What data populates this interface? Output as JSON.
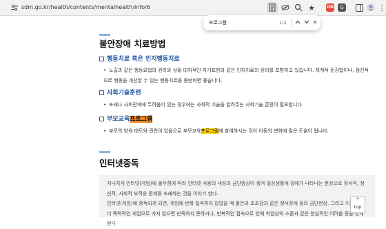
{
  "browser": {
    "url": "sdm.go.kr/health/contents/mentalhealth/info/6",
    "ext_red_label": "ON",
    "ext_gray_label": "G"
  },
  "find": {
    "query": "프로그램",
    "count": "1/2"
  },
  "section1": {
    "title": "불안장애 치료방법",
    "items": [
      {
        "heading": "행동치료 혹은 인지행동치료",
        "text": "노출과 같은 행동요법의 원리와 상황 대처적인 자기표현과 같은 인지치료의 원리를 포함하고 있습니다. 체계적 둔감법이나, 점진적으로 행동을 개선할 수 있는 행동치료를 동반하면 좋습니다."
      },
      {
        "heading": "사회기술훈련",
        "text": "또래나 사회관계에 두려움이 있는 경우에는 사회적 기술을 알려주는 사회기술 훈련이 필요합니다."
      },
      {
        "heading_prefix": "부모교육",
        "heading_match": "프로그램",
        "text_before": "부모의 양육 태도와 관련이 있음으로 부모교육",
        "text_match": "프로그램",
        "text_after": "에 참여하시는 것이 아동의 변화에 많은 도움이 됩니다."
      }
    ]
  },
  "section2": {
    "title": "인터넷중독",
    "paragraph1": "지나치게 인터넷(게임)에 몰두함에 따라 인터넷 사용의 내성과 금단증상이 생겨 일상생활에 장애가 나타나는 현상으로 정서적, 정신적, 사회적 부적응 문제를 초래하는 것을 이야기 한다.",
    "paragraph2": "인터넷(게임)에 중독되게 되면, 게임에 반복 접속하지 않았을 때 불안과 초조감과 같은 정서장애 등의 금단현상, 그리고 이로 인해 더 폭력적인 게임으로 가지 않으면 만족하지 못하거나, 반복적인 접속으로 인해 학업상의 소홀과 같은 현실적인 어려움 등을 갖게 된다"
  },
  "top_button": "top"
}
